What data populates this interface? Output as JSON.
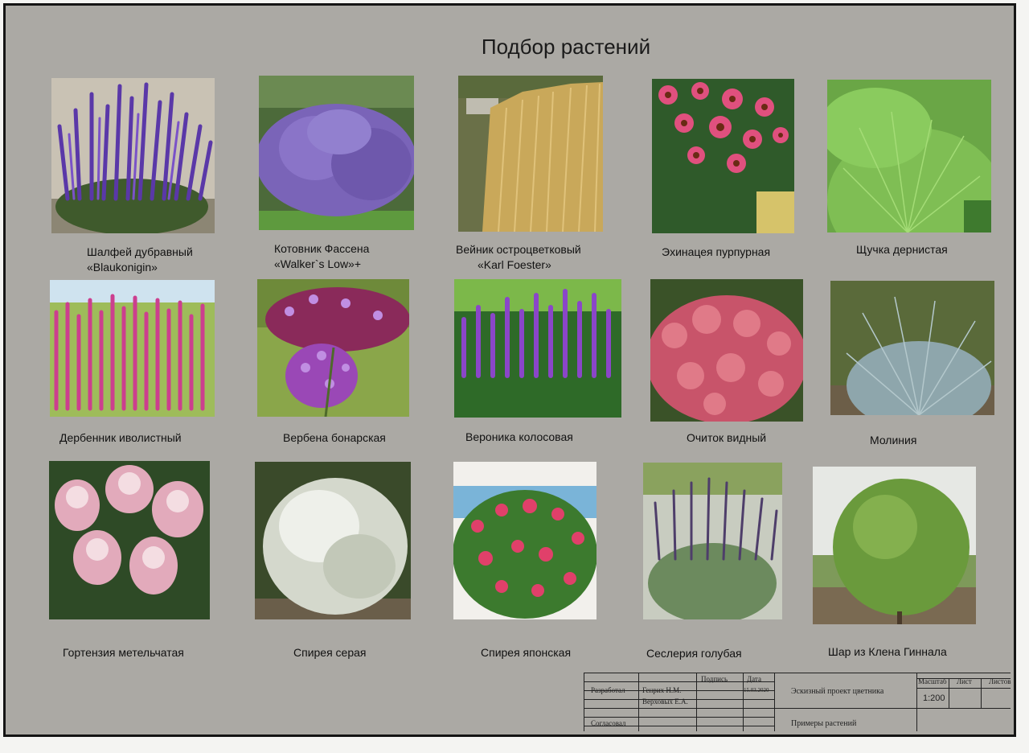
{
  "page": {
    "title": "Подбор растений"
  },
  "plants": [
    {
      "line1": "Шалфей дубравный",
      "line2": "«Blaukonigin»"
    },
    {
      "line1": "Котовник Фассена",
      "line2": "«Walker`s Low»+"
    },
    {
      "line1": "Вейник остроцветковый",
      "line2": "«Karl Foester»"
    },
    {
      "line1": "Эхинацея пурпурная"
    },
    {
      "line1": "Щучка дернистая"
    },
    {
      "line1": "Дербенник иволистный"
    },
    {
      "line1": "Вербена бонарская"
    },
    {
      "line1": "Вероника колосовая"
    },
    {
      "line1": "Очиток видный"
    },
    {
      "line1": "Молиния"
    },
    {
      "line1": "Гортензия метельчатая"
    },
    {
      "line1": "Спирея серая"
    },
    {
      "line1": "Спирея японская"
    },
    {
      "line1": "Сеслерия голубая"
    },
    {
      "line1": "Шар из Клена Гиннала"
    }
  ],
  "title_block": {
    "podpis": "Подпись",
    "data": "Дата",
    "razrabotal": "Разработал",
    "author1": "Генрих Н.М.",
    "date1": "15.03.2020",
    "author2": "Верховых Е.А.",
    "soglasoval": "Согласовал",
    "project": "Эскизный проект цветника",
    "sheet_title": "Примеры растений",
    "masshtab": "Масштаб",
    "list": "Лист",
    "listov": "Листов",
    "scale": "1:200"
  },
  "colors": {
    "sheet_bg": "#aba9a4",
    "border": "#141414"
  }
}
